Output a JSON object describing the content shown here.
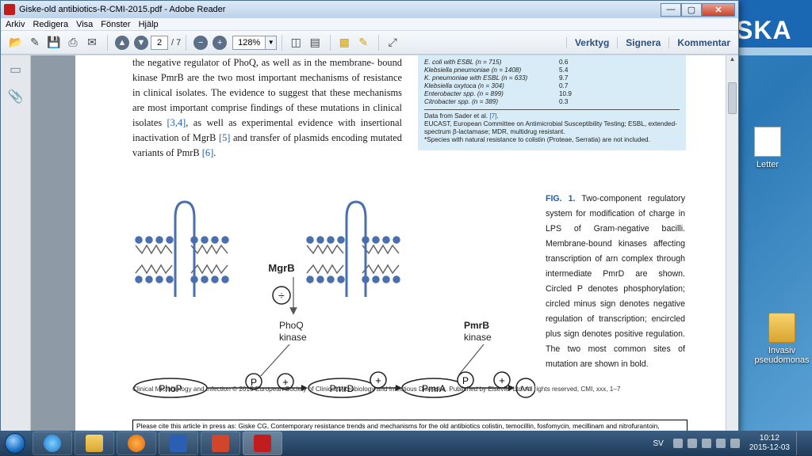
{
  "window": {
    "title": "Giske-old antibiotics-R-CMI-2015.pdf - Adobe Reader",
    "controls": {
      "minimize": "—",
      "maximize": "▢",
      "close": "✕"
    }
  },
  "menu": [
    "Arkiv",
    "Redigera",
    "Visa",
    "Fönster",
    "Hjälp"
  ],
  "toolbar": {
    "page_current": "2",
    "page_total": "/ 7",
    "zoom": "128%",
    "links": [
      "Verktyg",
      "Signera",
      "Kommentar"
    ]
  },
  "background_app": {
    "text": "SKA"
  },
  "document": {
    "body_lines": [
      "the negative regulator of PhoQ, as well as in the membrane-",
      "bound kinase PmrB are the two most important mechanisms",
      "of resistance in clinical isolates. The evidence to suggest that",
      "these mechanisms are most important comprise findings of",
      "these mutations in clinical isolates ",
      "[3,4]",
      ", as well as experimental",
      "evidence with insertional inactivation of MgrB ",
      "[5]",
      " and transfer",
      "of plasmids encoding mutated variants of PmrB ",
      "[6]",
      "."
    ],
    "table_rows": [
      {
        "label": "E. coli with ESBL (n = 715)",
        "value": "0.6"
      },
      {
        "label": "Klebsiella pneumoniae (n = 1408)",
        "value": "5.4"
      },
      {
        "label": "K. pneumoniae with ESBL (n = 633)",
        "value": "9.7"
      },
      {
        "label": "Klebsiella oxytoca (n = 304)",
        "value": "0.7"
      },
      {
        "label": "Enterobacter spp. (n = 899)",
        "value": "10.9"
      },
      {
        "label": "Citrobacter spp. (n = 389)",
        "value": "0.3"
      }
    ],
    "table_note_1a": "Data from Sader et al. ",
    "table_note_1ref": "[7]",
    "table_note_1b": ".",
    "table_note_2": "EUCAST, European Committee on Antimicrobial Susceptibility Testing; ESBL, extended-spectrum β-lactamase; MDR, multidrug resistant.",
    "table_note_3": "*Species with natural resistance to colistin (Proteae, Serratia) are not included.",
    "figure_labels": {
      "mgrb": "MgrB",
      "phoq1": "PhoQ",
      "phoq2": "kinase",
      "pmrb1": "PmrB",
      "pmrb2": "kinase",
      "phop": "PhoP",
      "pmrd": "PmrD",
      "pmra": "PmrA",
      "arn": "Arn",
      "p": "P",
      "plus": "+",
      "minus": "÷"
    },
    "caption_label": "FIG. 1.",
    "caption_text": " Two-component regulatory system for modification of charge in LPS of Gram-negative bacilli. Membrane-bound kinases affecting transcription of arn complex through intermediate PmrD are shown. Circled P denotes phosphorylation; circled minus sign denotes negative regulation of transcription; encircled plus sign denotes positive regulation. The two most common sites of mutation are shown in bold.",
    "footer": "Clinical Microbiology and Infection © 2015 European Society of Clinical Microbiology and Infectious Diseases. Published by Elsevier Ltd. All rights reserved, CMI, xxx, 1–7",
    "cite": "Please cite this article in press as: Giske CG, Contemporary resistance trends and mechanisms for the old antibiotics colistin, temocillin, fosfomycin, mecillinam and nitrofurantoin,"
  },
  "desktop_icons": [
    {
      "label": "Letter"
    },
    {
      "label": "Invasiv pseudomonas"
    }
  ],
  "taskbar": {
    "language": "SV",
    "time": "10:12",
    "date": "2015-12-03"
  }
}
